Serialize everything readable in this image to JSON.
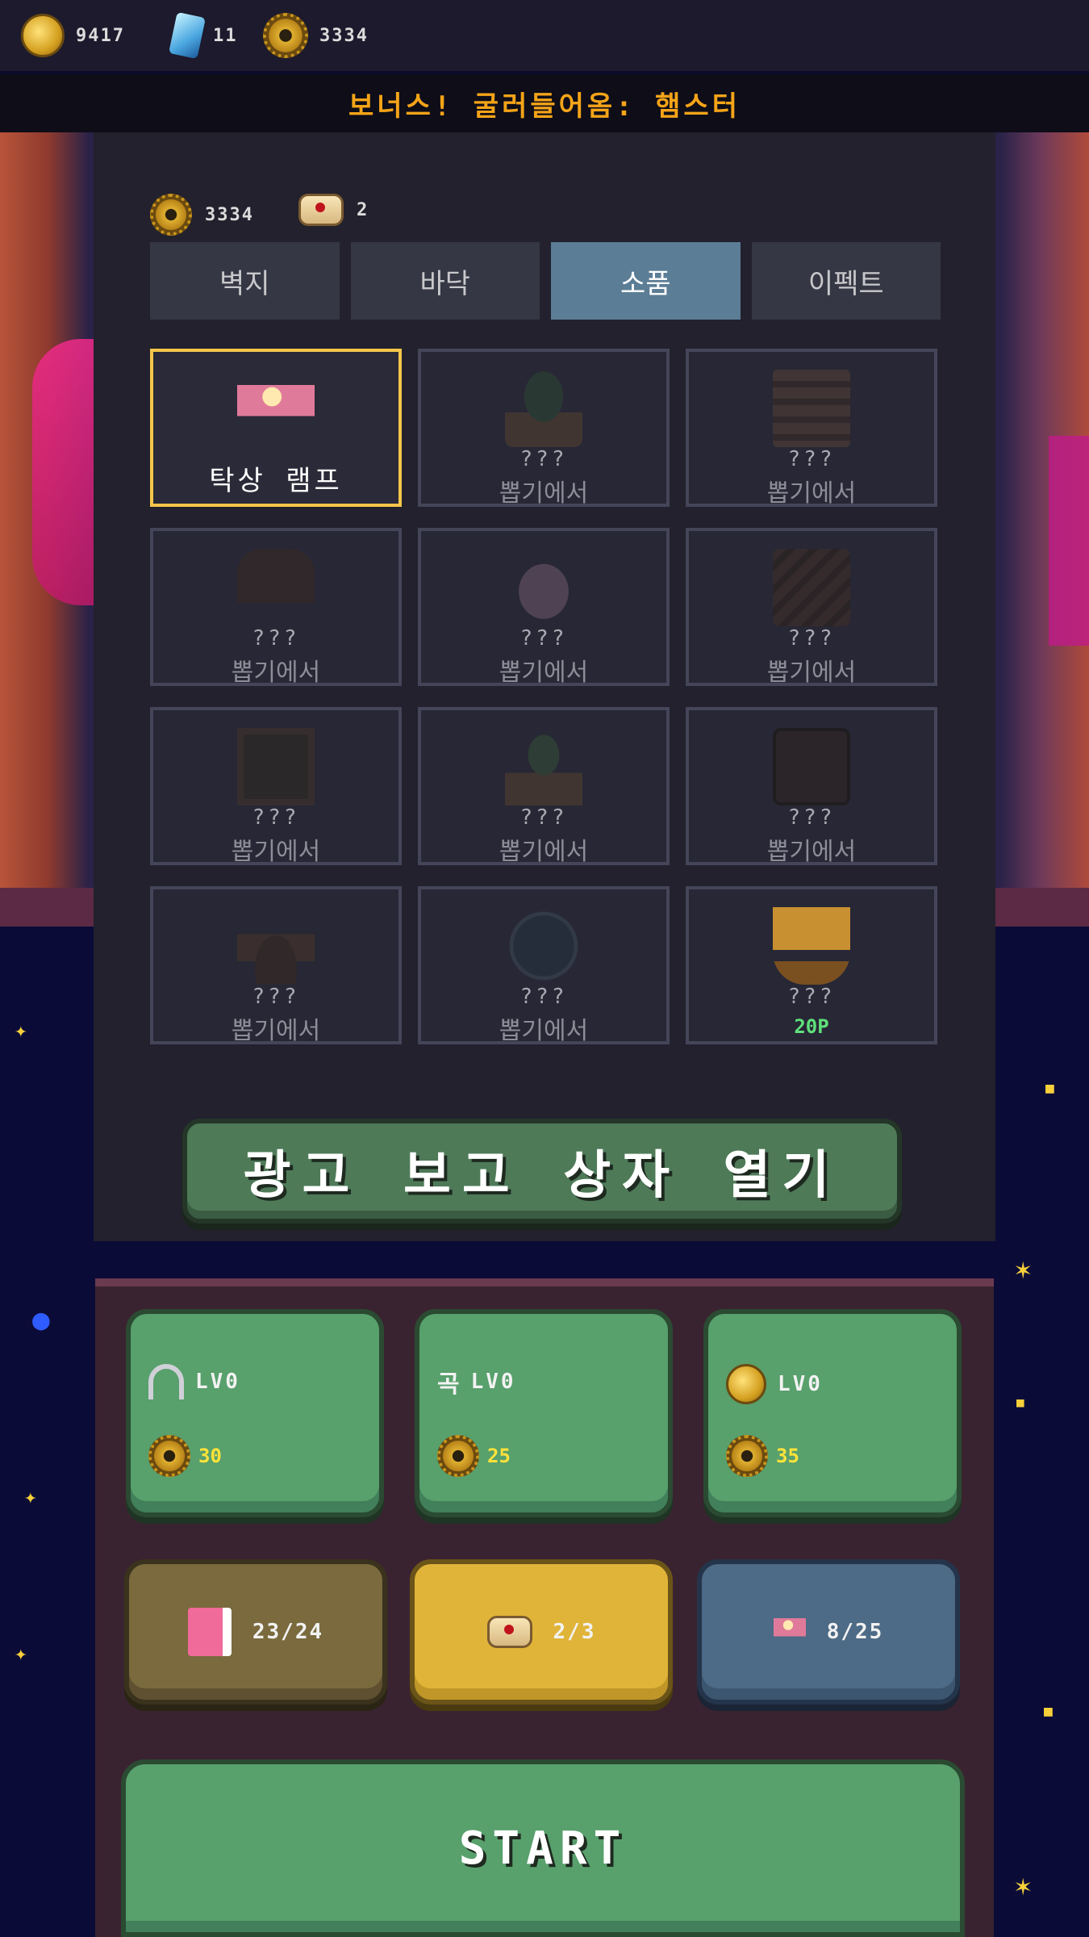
{
  "hud": {
    "coins": "9417",
    "gems": "11",
    "gears": "3334"
  },
  "banner": {
    "text": "보너스! 굴러들어옴: 햄스터"
  },
  "shop": {
    "resources": {
      "gears": "3334",
      "scrolls": "2"
    },
    "tabs": [
      {
        "label": "벽지",
        "active": false
      },
      {
        "label": "바닥",
        "active": false
      },
      {
        "label": "소품",
        "active": true
      },
      {
        "label": "이펙트",
        "active": false
      }
    ],
    "items": [
      {
        "icon": "lamp",
        "name": "탁상 램프",
        "sub": "",
        "state": "selected"
      },
      {
        "icon": "plant",
        "name": "???",
        "sub": "뽑기에서",
        "state": "locked"
      },
      {
        "icon": "books",
        "name": "???",
        "sub": "뽑기에서",
        "state": "locked"
      },
      {
        "icon": "cuckoo-clock",
        "name": "???",
        "sub": "뽑기에서",
        "state": "locked"
      },
      {
        "icon": "cushion",
        "name": "???",
        "sub": "뽑기에서",
        "state": "locked"
      },
      {
        "icon": "logs",
        "name": "???",
        "sub": "뽑기에서",
        "state": "locked"
      },
      {
        "icon": "star-frame",
        "name": "???",
        "sub": "뽑기에서",
        "state": "locked"
      },
      {
        "icon": "cactus",
        "name": "???",
        "sub": "뽑기에서",
        "state": "locked"
      },
      {
        "icon": "radio",
        "name": "???",
        "sub": "뽑기에서",
        "state": "locked"
      },
      {
        "icon": "coffee-cup",
        "name": "???",
        "sub": "뽑기에서",
        "state": "locked"
      },
      {
        "icon": "fishbowl",
        "name": "???",
        "sub": "뽑기에서",
        "state": "locked"
      },
      {
        "icon": "trophy",
        "name": "???",
        "sub": "20P",
        "state": "price"
      }
    ],
    "ad_button": "광고 보고 상자 열기"
  },
  "upgrades": [
    {
      "icon": "magnet",
      "level": "LV0",
      "cost": "30"
    },
    {
      "icon": "pickaxe",
      "glyph": "곡",
      "level": "LV0",
      "cost": "25"
    },
    {
      "icon": "coin",
      "level": "LV0",
      "cost": "35"
    }
  ],
  "collections": {
    "book": "23/24",
    "scroll": "2/3",
    "lamp": "8/25"
  },
  "start_label": "START",
  "colors": {
    "accent_orange": "#f5a418",
    "tab_active": "#5b7d96",
    "button_green": "#58a06c",
    "selected_border": "#f4c64a",
    "price_green": "#5fe07a"
  }
}
